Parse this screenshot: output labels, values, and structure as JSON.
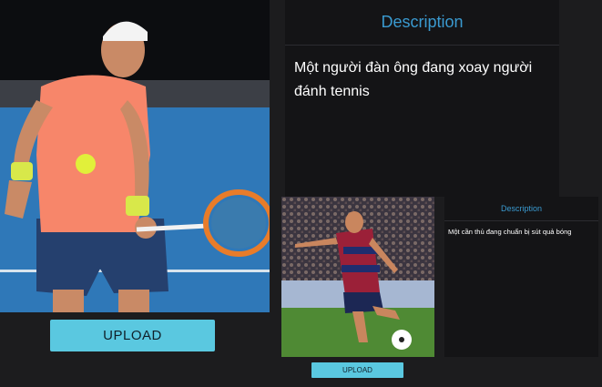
{
  "main": {
    "image_alt": "tennis player photo",
    "upload_label": "UPLOAD",
    "description_title": "Description",
    "description_text": "Một người đàn ông đang xoay người đánh tennis"
  },
  "secondary": {
    "image_alt": "soccer player photo",
    "upload_label": "UPLOAD",
    "description_title": "Description",
    "description_text": "Một cần thủ đang chuẩn bị sút quả bóng"
  },
  "colors": {
    "accent": "#5ac8e0",
    "title": "#3a9ad0",
    "panel": "#141416",
    "background": "#1c1c1e"
  }
}
